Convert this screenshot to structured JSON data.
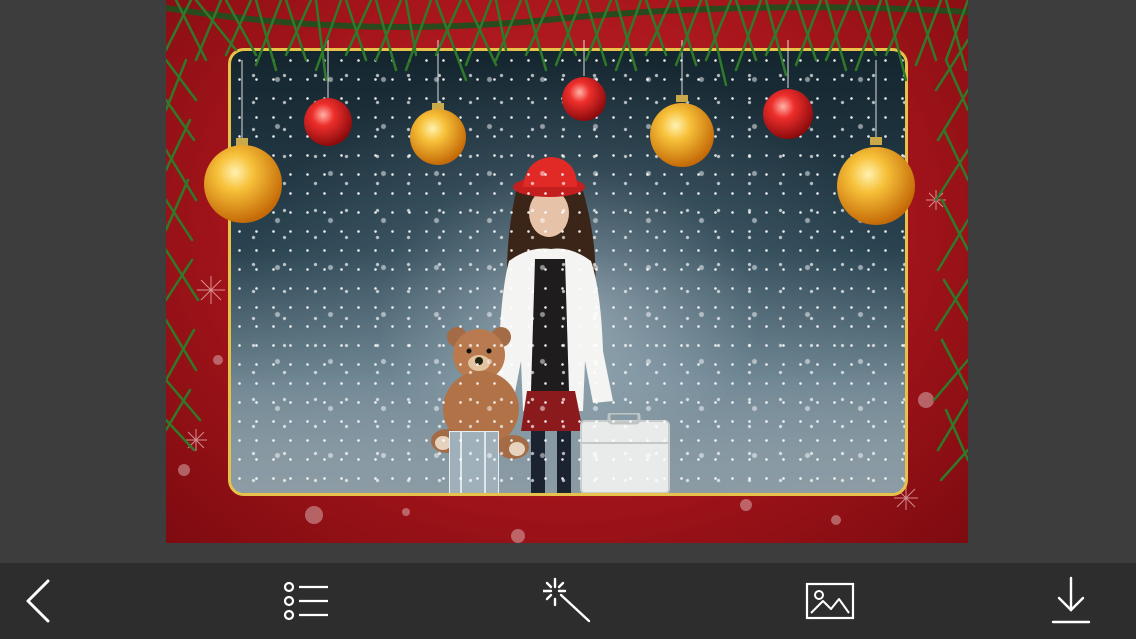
{
  "toolbar": {
    "items": [
      {
        "name": "back-button",
        "icon": "chevron-left-icon"
      },
      {
        "name": "frames-list-button",
        "icon": "list-icon"
      },
      {
        "name": "effects-button",
        "icon": "magic-wand-icon"
      },
      {
        "name": "gallery-button",
        "icon": "image-icon"
      },
      {
        "name": "download-button",
        "icon": "download-icon"
      }
    ]
  },
  "colors": {
    "background": "#3d3d3e",
    "toolbar": "#2d2d2e",
    "frame_red": "#b5181e",
    "frame_border_gold": "#e6c24a",
    "ornament_gold": "#f2a81d",
    "ornament_red": "#e0202a",
    "icon": "#ffffff"
  }
}
